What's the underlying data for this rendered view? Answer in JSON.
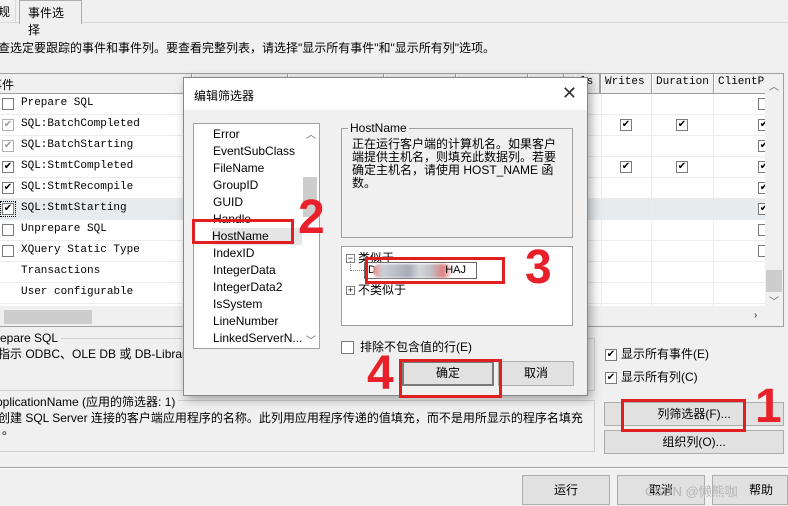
{
  "tabs": [
    {
      "label": "规"
    },
    {
      "label": "事件选择"
    }
  ],
  "instruction": "查选定要跟踪的事件和事件列。要查看完整列表，请选择\"显示所有事件\"和\"显示所有列\"选项。",
  "grid": {
    "columns": [
      "事件",
      "",
      "",
      "",
      "",
      "",
      "",
      "ls",
      "Writes",
      "Duration",
      "ClientPr"
    ],
    "rows": [
      {
        "name": "Prepare SQL",
        "checked": "none",
        "writes": false,
        "duration": false,
        "clientpr": false
      },
      {
        "name": "SQL:BatchCompleted",
        "checked": "grey",
        "writes": true,
        "duration": true,
        "clientpr": true
      },
      {
        "name": "SQL:BatchStarting",
        "checked": "grey",
        "writes": false,
        "duration": false,
        "clientpr": true
      },
      {
        "name": "SQL:StmtCompleted",
        "checked": "checked",
        "writes": true,
        "duration": true,
        "clientpr": true
      },
      {
        "name": "SQL:StmtRecompile",
        "checked": "checked",
        "writes": false,
        "duration": false,
        "clientpr": true
      },
      {
        "name": "SQL:StmtStarting",
        "checked": "checked",
        "writes": false,
        "duration": false,
        "clientpr": true,
        "selected": true
      },
      {
        "name": "Unprepare SQL",
        "checked": "none",
        "writes": false,
        "duration": false,
        "clientpr": false
      },
      {
        "name": "XQuery Static Type",
        "checked": "none",
        "writes": false,
        "duration": false,
        "clientpr": false
      },
      {
        "name": "Transactions",
        "category": true
      },
      {
        "name": "User configurable",
        "category": true
      }
    ]
  },
  "event_info": {
    "title": "repare SQL",
    "description": "指示 ODBC、OLE DB 或 DB-Library 将"
  },
  "column_info": {
    "title": "pplicationName (应用的筛选器: 1)",
    "description_line1": "创建 SQL Server 连接的客户端应用程序的名称。此列用应用程序传递的值填充，而不是用所显示的程序名填充",
    "description_line2": "。"
  },
  "options": {
    "show_all_events": {
      "label": "显示所有事件(E)",
      "checked": true
    },
    "show_all_columns": {
      "label": "显示所有列(C)",
      "checked": true
    }
  },
  "buttons": {
    "column_filters": "列筛选器(F)...",
    "organize_columns": "组织列(O)...",
    "run": "运行",
    "cancel": "取消",
    "help": "帮助"
  },
  "dialog": {
    "title": "编辑筛选器",
    "columns": [
      "Error",
      "EventSubClass",
      "FileName",
      "GroupID",
      "GUID",
      "Handle",
      "HostName",
      "IndexID",
      "IntegerData",
      "IntegerData2",
      "IsSystem",
      "LineNumber",
      "LinkedServerN..."
    ],
    "selected_column": "HostName",
    "info_title": "HostName",
    "info_text": "正在运行客户端的计算机名。如果客户端提供主机名，则填充此数据列。若要确定主机名，请使用 HOST_NAME 函数。",
    "tree": {
      "like_label": "类似于",
      "like_value_start": "D",
      "like_value_end": "HAJ",
      "not_like_label": "不类似于"
    },
    "exclude_label": "排除不包含值的行(E)",
    "exclude_checked": false,
    "ok": "确定",
    "cancel": "取消"
  },
  "annotations": [
    "1",
    "2",
    "3",
    "4"
  ],
  "watermark": "CSDN @懒熊咖"
}
